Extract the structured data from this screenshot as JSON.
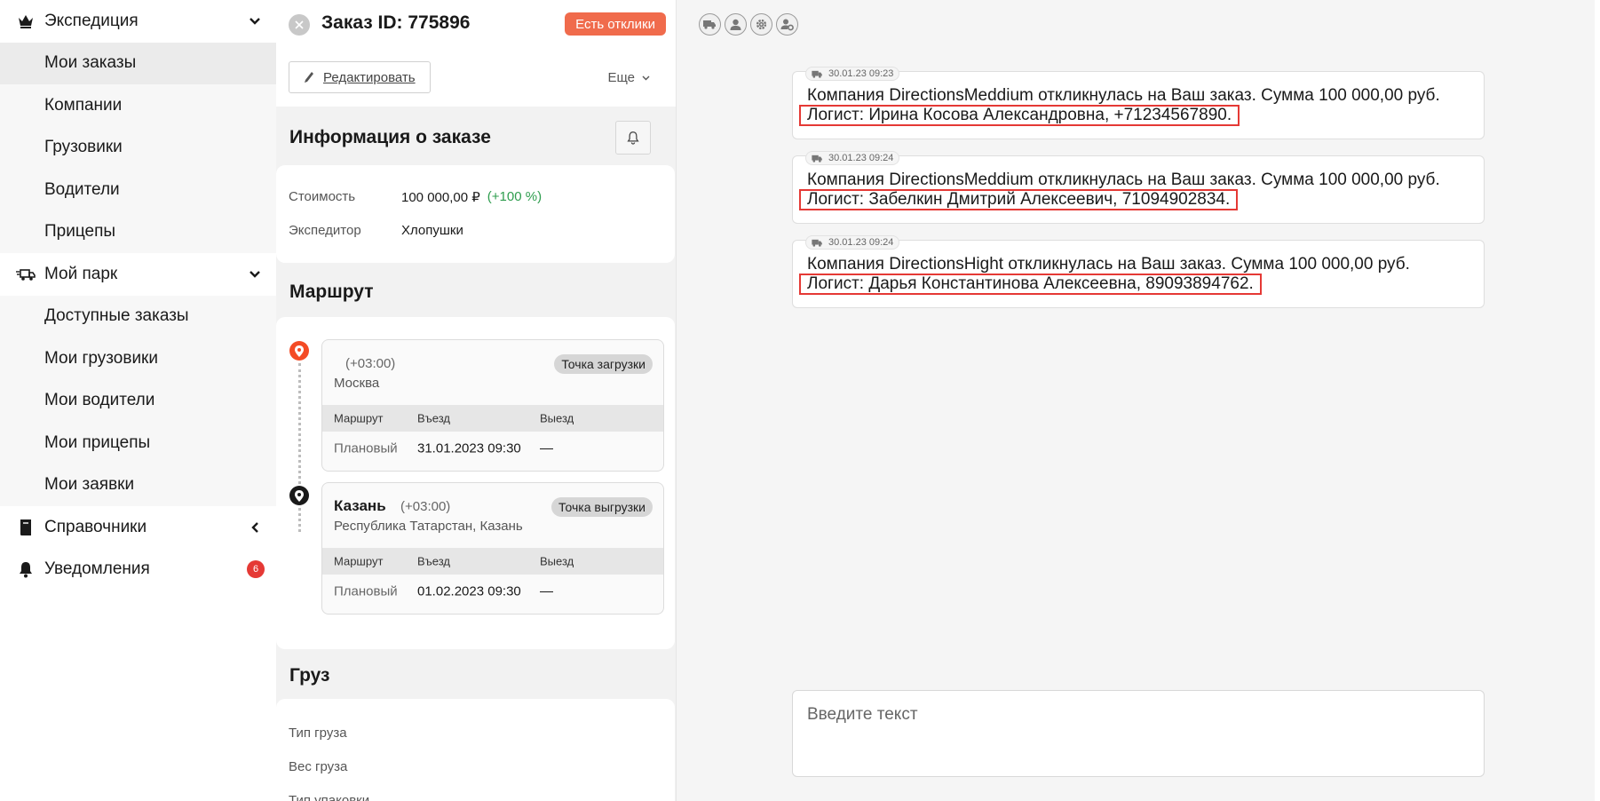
{
  "sidebar": {
    "expedition": {
      "label": "Экспедиция"
    },
    "expedition_items": [
      {
        "label": "Мои заказы"
      },
      {
        "label": "Компании"
      },
      {
        "label": "Грузовики"
      },
      {
        "label": "Водители"
      },
      {
        "label": "Прицепы"
      }
    ],
    "park": {
      "label": "Мой парк"
    },
    "park_items": [
      {
        "label": "Доступные заказы"
      },
      {
        "label": "Мои грузовики"
      },
      {
        "label": "Мои водители"
      },
      {
        "label": "Мои прицепы"
      },
      {
        "label": "Мои заявки"
      }
    ],
    "directories": {
      "label": "Справочники"
    },
    "notifications": {
      "label": "Уведомления",
      "badge": "6"
    }
  },
  "order": {
    "title": "Заказ ID: 775896",
    "responses_label": "Есть отклики",
    "edit_label": "Редактировать",
    "more_label": "Еще",
    "info_title": "Информация о заказе",
    "cost_label": "Стоимость",
    "cost_value": "100 000,00 ₽",
    "cost_pct": "(+100 %)",
    "forwarder_label": "Экспедитор",
    "forwarder_value": "Хлопушки",
    "route_title": "Маршрут",
    "stops": [
      {
        "city": "",
        "tz": "(+03:00)",
        "address": "Москва",
        "tag": "Точка загрузки",
        "col_route": "Маршрут",
        "col_in": "Въезд",
        "col_out": "Выезд",
        "row_route": "Плановый",
        "row_in": "31.01.2023 09:30",
        "row_out": "—"
      },
      {
        "city": "Казань",
        "tz": "(+03:00)",
        "address": "Республика Татарстан, Казань",
        "tag": "Точка выгрузки",
        "col_route": "Маршрут",
        "col_in": "Въезд",
        "col_out": "Выезд",
        "row_route": "Плановый",
        "row_in": "01.02.2023 09:30",
        "row_out": "—"
      }
    ],
    "cargo_title": "Груз",
    "cargo_rows": [
      {
        "label": "Тип груза"
      },
      {
        "label": "Вес груза"
      },
      {
        "label": "Тип упаковки"
      }
    ]
  },
  "chat": {
    "messages": [
      {
        "time": "30.01.23 09:23",
        "line1": "Компания DirectionsMeddium откликнулась на Ваш заказ. Сумма 100 000,00 руб.",
        "line2": "Логист: Ирина Косова Александровна, +71234567890."
      },
      {
        "time": "30.01.23 09:24",
        "line1": "Компания DirectionsMeddium откликнулась на Ваш заказ. Сумма 100 000,00 руб.",
        "line2": "Логист: Забелкин Дмитрий Алексеевич, 71094902834."
      },
      {
        "time": "30.01.23 09:24",
        "line1": "Компания DirectionsHight откликнулась на Ваш заказ. Сумма 100 000,00 руб.",
        "line2": "Логист: Дарья Константинова Алексеевна, 89093894762."
      }
    ],
    "input_placeholder": "Введите текст",
    "filter_icons": [
      "truck-icon",
      "user-icon",
      "gear-icon",
      "user-settings-icon"
    ]
  },
  "colors": {
    "accent": "#f06b4c",
    "positive": "#2e9d4e",
    "badge": "#e53935",
    "highlight_border": "#e53935"
  }
}
